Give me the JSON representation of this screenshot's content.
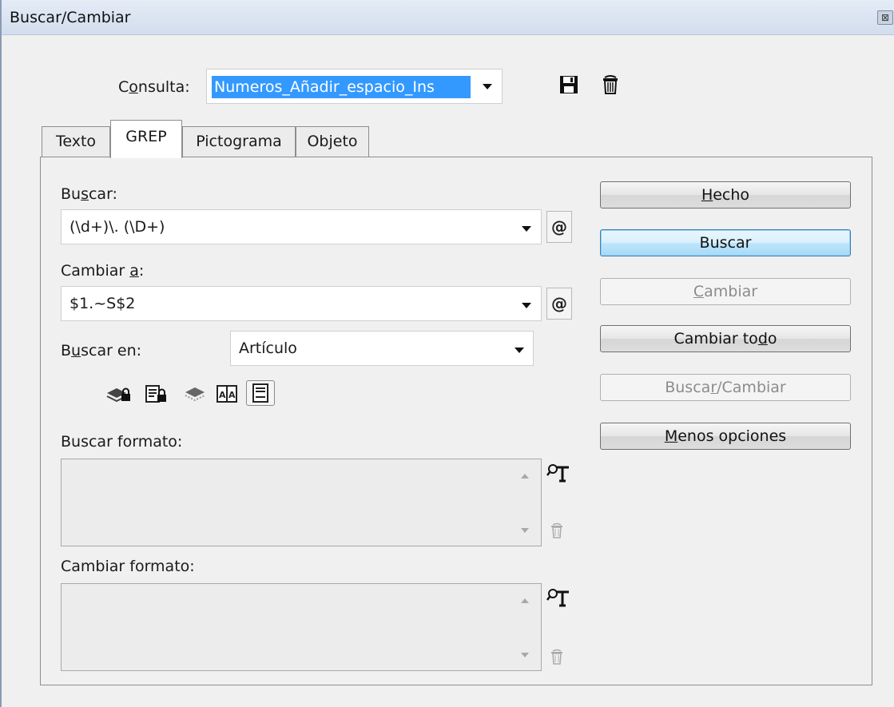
{
  "window": {
    "title": "Buscar/Cambiar",
    "close_glyph": "⊠"
  },
  "consulta": {
    "label_pre": "C",
    "label_u": "o",
    "label_post": "nsulta:",
    "value": "Numeros_Añadir_espacio_Ins"
  },
  "tabs": [
    {
      "label": "Texto"
    },
    {
      "label": "GREP",
      "active": true
    },
    {
      "label": "Pictograma"
    },
    {
      "label": "Objeto"
    }
  ],
  "buscar": {
    "label_pre": "Bu",
    "label_u": "s",
    "label_post": "car:",
    "value": "(\\d+)\\. (\\D+)"
  },
  "cambiar_a": {
    "label_pre": "Cambiar ",
    "label_u": "a",
    "label_post": ":",
    "value": "$1.~S$2"
  },
  "buscar_en": {
    "label_pre": "B",
    "label_u": "u",
    "label_post": "scar en:",
    "value": "Artículo"
  },
  "special_char_glyph": "@",
  "buscar_formato": {
    "label": "Buscar formato:"
  },
  "cambiar_formato": {
    "label": "Cambiar formato:"
  },
  "buttons": {
    "hecho": {
      "pre": "",
      "u": "H",
      "post": "echo"
    },
    "buscar": {
      "label": "Buscar"
    },
    "cambiar": {
      "pre": "",
      "u": "C",
      "post": "ambiar"
    },
    "cambiar_todo": {
      "pre": "Cambiar to",
      "u": "d",
      "post": "o"
    },
    "buscar_cambiar": {
      "pre": "Busca",
      "u": "r",
      "post": "/Cambiar"
    },
    "menos_opciones": {
      "pre": "",
      "u": "M",
      "post": "enos opciones"
    }
  }
}
